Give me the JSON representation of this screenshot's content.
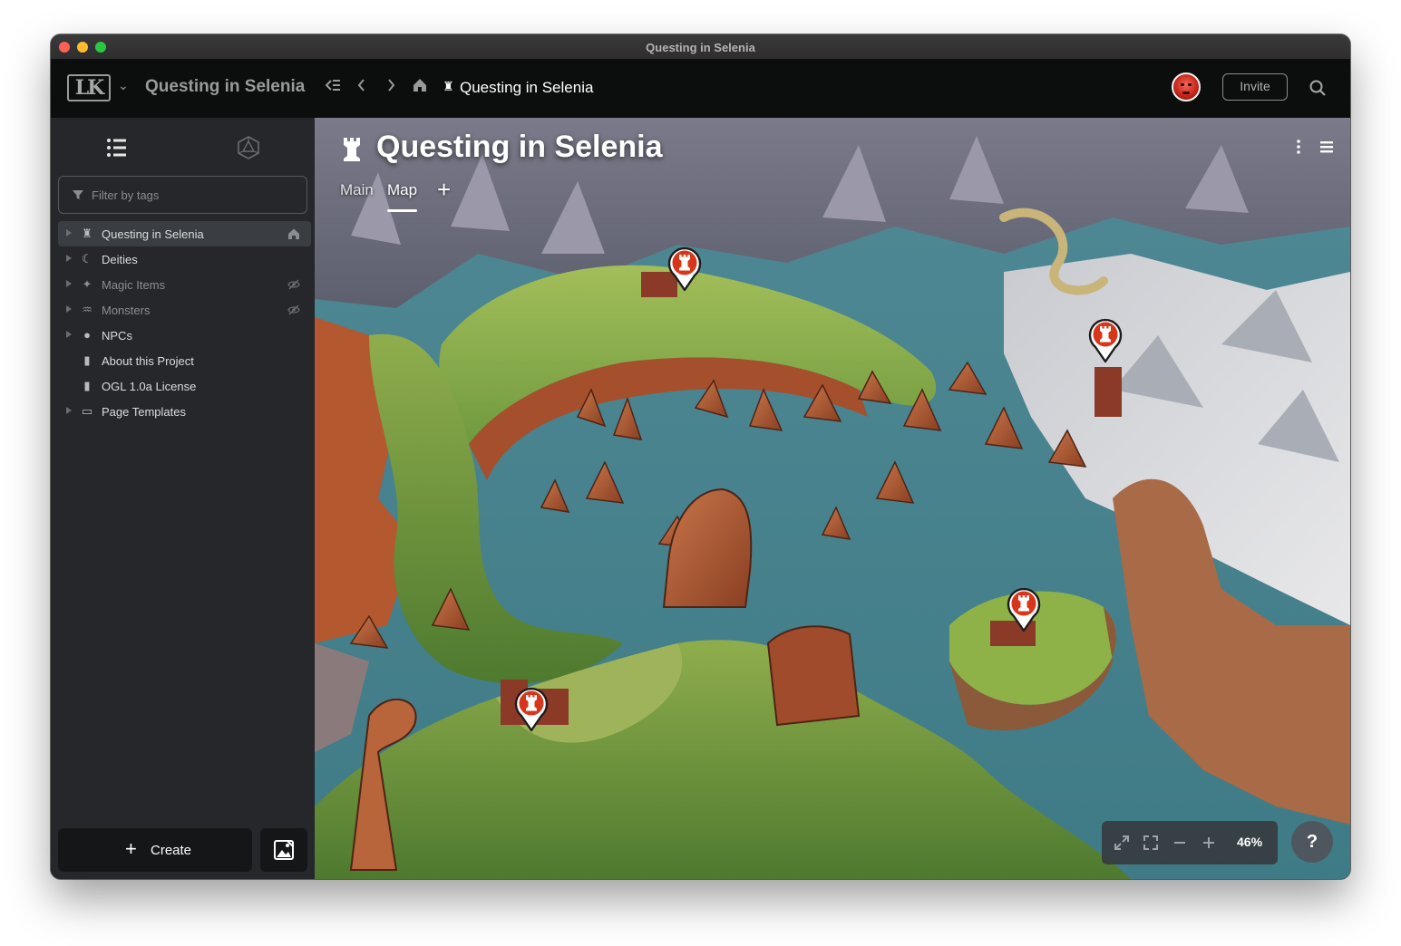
{
  "window": {
    "title": "Questing in Selenia"
  },
  "appbar": {
    "logo_text": "LK",
    "project_name": "Questing in Selenia",
    "breadcrumb": "Questing in Selenia",
    "invite_label": "Invite"
  },
  "sidebar": {
    "filter_placeholder": "Filter by tags",
    "items": [
      {
        "label": "Questing in Selenia",
        "icon": "rook-icon",
        "expandable": true,
        "active": true,
        "badge": "home-icon"
      },
      {
        "label": "Deities",
        "icon": "moon-icon",
        "expandable": true
      },
      {
        "label": "Magic Items",
        "icon": "sparkles-icon",
        "expandable": true,
        "hidden": true,
        "badge": "eye-off-icon"
      },
      {
        "label": "Monsters",
        "icon": "dragon-icon",
        "expandable": true,
        "hidden": true,
        "badge": "eye-off-icon"
      },
      {
        "label": "NPCs",
        "icon": "person-icon",
        "expandable": true
      },
      {
        "label": "About this Project",
        "icon": "book-icon",
        "expandable": false
      },
      {
        "label": "OGL 1.0a License",
        "icon": "book-icon",
        "expandable": false
      },
      {
        "label": "Page Templates",
        "icon": "folder-icon",
        "expandable": true
      }
    ],
    "create_label": "Create"
  },
  "page": {
    "title": "Questing in Selenia",
    "tabs": [
      {
        "label": "Main",
        "active": false
      },
      {
        "label": "Map",
        "active": true
      }
    ]
  },
  "map": {
    "pins": [
      {
        "icon": "rook-icon",
        "color": "#d8361b"
      },
      {
        "icon": "rook-icon",
        "color": "#d8361b"
      },
      {
        "icon": "rook-icon",
        "color": "#d8361b"
      },
      {
        "icon": "rook-icon",
        "color": "#d8361b"
      }
    ],
    "zoom": "46%",
    "help_label": "?"
  },
  "colors": {
    "accent_pin": "#d8361b",
    "sidebar_bg": "#25272a",
    "appbar_bg": "#0c0d0d",
    "water": "#4e8b96"
  }
}
